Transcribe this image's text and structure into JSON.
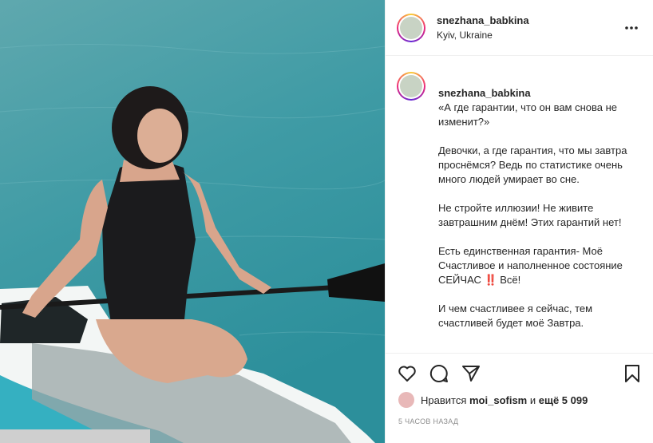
{
  "post": {
    "username": "snezhana_babkina",
    "location": "Kyiv, Ukraine",
    "caption": {
      "first_line": "«А где гарантии, что он вам снова не изменит?»",
      "paragraphs": [
        "Девочки, а где гарантия, что мы завтра проснёмся? Ведь по статистике очень много людей умирает во сне.",
        "Не стройте иллюзии! Не живите завтрашним днём! Этих гарантий нет!",
        "Есть единственная гарантия- Моё Счастливое и наполненное состояние СЕЙЧАС ‼️ Всё!",
        "И чем счастливее я сейчас, тем счастливей будет моё Завтра."
      ]
    },
    "likes": {
      "prefix": "Нравится",
      "user": "moi_sofism",
      "and": "и",
      "more": "ещё 5 099"
    },
    "time": "5 ЧАСОВ НАЗАД"
  },
  "icons": {
    "more": "more-horizontal-icon",
    "like": "heart-icon",
    "comment": "comment-icon",
    "share": "paper-plane-icon",
    "save": "bookmark-icon"
  },
  "colors": {
    "water": "#3d9aa4",
    "board": "#3bb3c3",
    "text": "#262626",
    "muted": "#8e8e8e",
    "border": "#efefef"
  }
}
